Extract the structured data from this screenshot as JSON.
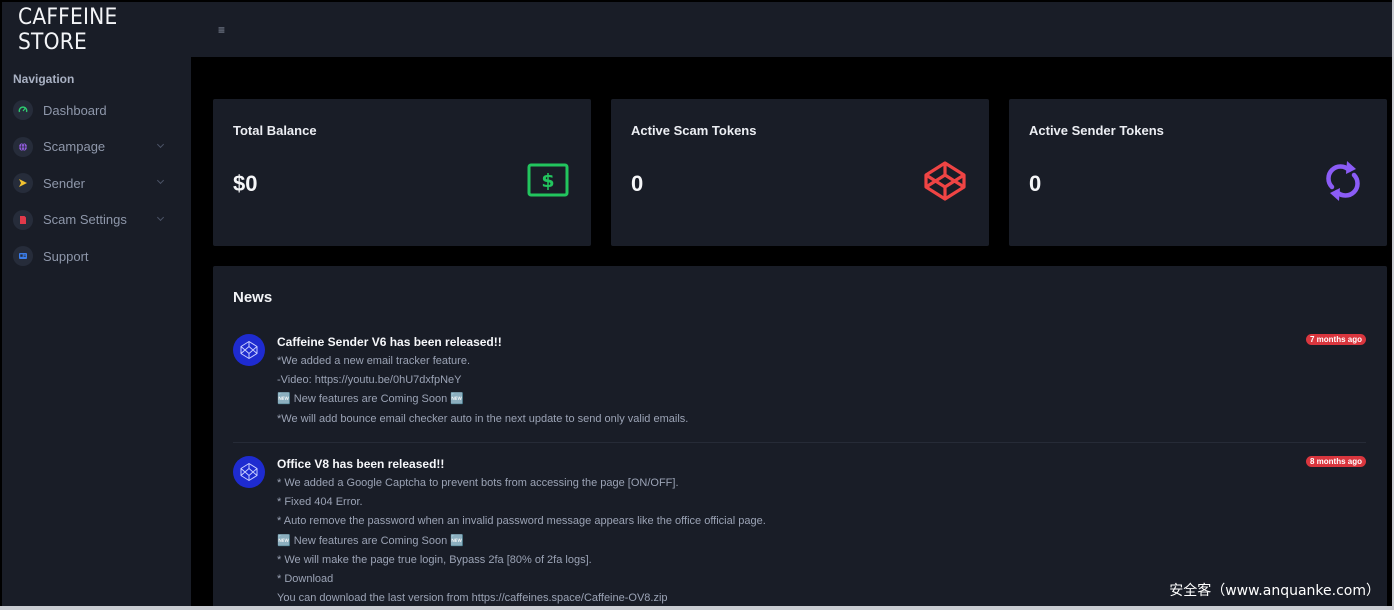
{
  "header": {
    "brand": "CAFFEINE STORE",
    "menu_icon": "≡"
  },
  "sidebar": {
    "title": "Navigation",
    "items": [
      {
        "label": "Dashboard",
        "icon": "gauge-icon",
        "color": "#2ecc71"
      },
      {
        "label": "Scampage",
        "icon": "globe-icon",
        "color": "#8e5bd8"
      },
      {
        "label": "Sender",
        "icon": "send-icon",
        "color": "#f2c230"
      },
      {
        "label": "Scam Settings",
        "icon": "file-icon",
        "color": "#e0394a"
      },
      {
        "label": "Support",
        "icon": "id-card-icon",
        "color": "#3b7de9"
      }
    ]
  },
  "stats": [
    {
      "title": "Total Balance",
      "value": "$0",
      "icon": "dollar-bill-icon",
      "color": "#22c55e"
    },
    {
      "title": "Active Scam Tokens",
      "value": "0",
      "icon": "codepen-icon",
      "color": "#ef4444"
    },
    {
      "title": "Active Sender Tokens",
      "value": "0",
      "icon": "refresh-icon",
      "color": "#8b5cf6"
    }
  ],
  "news": {
    "title": "News",
    "items": [
      {
        "title": "Caffeine Sender V6 has been released!!",
        "badge": "7 months ago",
        "lines": [
          "*We added a new email tracker feature.",
          "-Video: https://youtu.be/0hU7dxfpNeY",
          "🆕 New features are Coming Soon 🆕",
          "*We will add bounce email checker auto in the next update to send only valid emails."
        ]
      },
      {
        "title": "Office V8 has been released!!",
        "badge": "8 months ago",
        "lines": [
          "* We added a Google Captcha to prevent bots from accessing the page [ON/OFF].",
          "* Fixed 404 Error.",
          "* Auto remove the password when an invalid password message appears like the office official page.",
          "🆕 New features are Coming Soon 🆕",
          "* We will make the page true login, Bypass 2fa [80% of 2fa logs].",
          "* Download",
          "You can download the last version from https://caffeines.space/Caffeine-OV8.zip"
        ]
      }
    ]
  },
  "watermark": "安全客（www.anquanke.com）"
}
